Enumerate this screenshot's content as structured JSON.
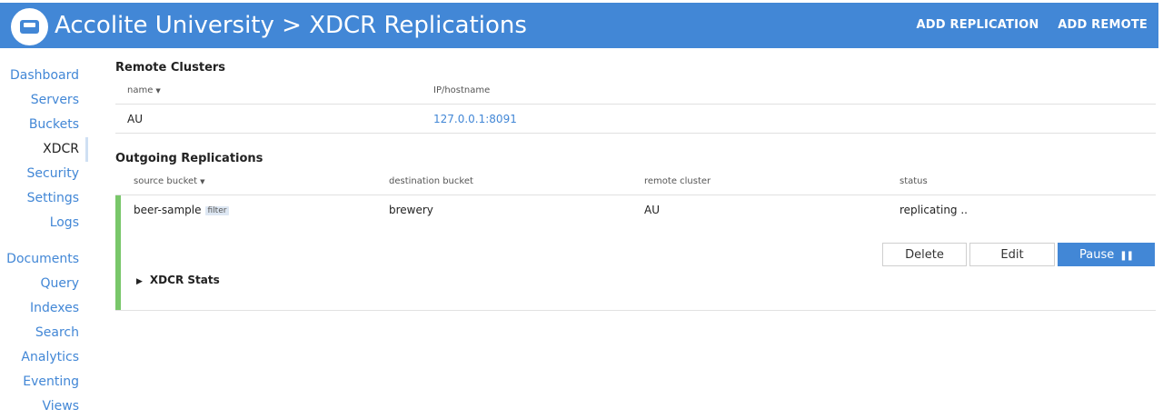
{
  "header": {
    "title": "Accolite University > XDCR Replications",
    "actions": [
      "ADD REPLICATION",
      "ADD REMOTE"
    ]
  },
  "sidebar": {
    "group1": [
      "Dashboard",
      "Servers",
      "Buckets",
      "XDCR",
      "Security",
      "Settings",
      "Logs"
    ],
    "group2": [
      "Documents",
      "Query",
      "Indexes",
      "Search",
      "Analytics",
      "Eventing",
      "Views"
    ],
    "active": "XDCR"
  },
  "remote_clusters": {
    "title": "Remote Clusters",
    "columns": [
      "name",
      "IP/hostname"
    ],
    "rows": [
      {
        "name": "AU",
        "ip": "127.0.0.1:8091"
      }
    ]
  },
  "outgoing": {
    "title": "Outgoing Replications",
    "columns": [
      "source bucket",
      "destination bucket",
      "remote cluster",
      "status"
    ],
    "rows": [
      {
        "source": "beer-sample",
        "filter_badge": "filter",
        "destination": "brewery",
        "remote": "AU",
        "status": "replicating .."
      }
    ],
    "buttons": {
      "delete": "Delete",
      "edit": "Edit",
      "pause": "Pause"
    },
    "stats_label": "XDCR Stats"
  },
  "colors": {
    "brand": "#4287d6",
    "status_ok": "#79c76a"
  }
}
